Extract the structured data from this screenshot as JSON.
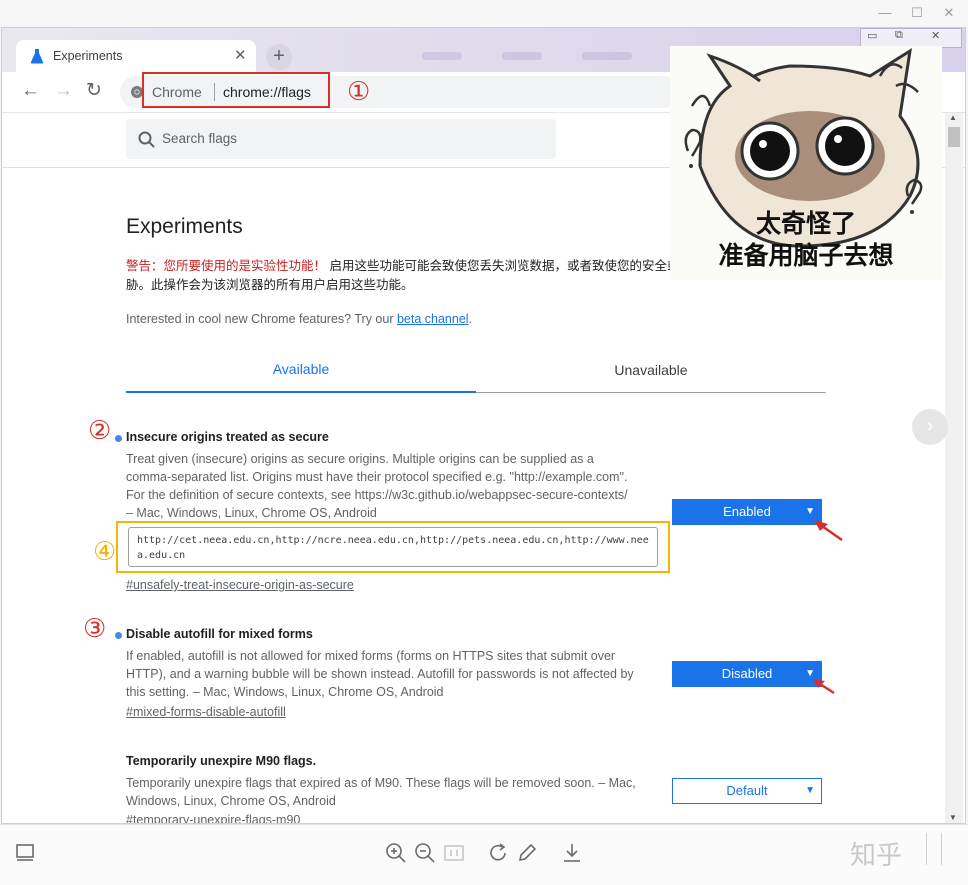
{
  "browser": {
    "tab_title": "Experiments",
    "new_tab_label": "+",
    "address": {
      "scheme_label": "Chrome",
      "url": "chrome://flags"
    }
  },
  "page": {
    "search_placeholder": "Search flags",
    "heading": "Experiments",
    "warning_red": "警告：您所要使用的是实验性功能！",
    "warning_rest": " 启用这些功能可能会致使您丢失浏览数据，或者致使您的安全或隐私受到威",
    "warning_line2": "胁。此操作会为该浏览器的所有用户启用这些功能。",
    "interest_text": "Interested in cool new Chrome features? Try our ",
    "beta_link": "beta channel",
    "interest_end": ".",
    "tabs": [
      {
        "label": "Available",
        "active": true
      },
      {
        "label": "Unavailable",
        "active": false
      }
    ]
  },
  "flags": [
    {
      "title": "Insecure origins treated as secure",
      "desc": [
        "Treat given (insecure) origins as secure origins. Multiple origins can be supplied as a",
        "comma-separated list. Origins must have their protocol specified e.g. \"http://example.com\".",
        "For the definition of secure contexts, see https://w3c.github.io/webappsec-secure-contexts/",
        "– Mac, Windows, Linux, Chrome OS, Android"
      ],
      "textarea": "http://cet.neea.edu.cn,http://ncre.neea.edu.cn,http://pets.neea.edu.cn,http://www.neea.edu.cn",
      "link": "#unsafely-treat-insecure-origin-as-secure",
      "select": "Enabled"
    },
    {
      "title": "Disable autofill for mixed forms",
      "desc": [
        "If enabled, autofill is not allowed for mixed forms (forms on HTTPS sites that submit over",
        "HTTP), and a warning bubble will be shown instead. Autofill for passwords is not affected by",
        "this setting. – Mac, Windows, Linux, Chrome OS, Android"
      ],
      "link": "#mixed-forms-disable-autofill",
      "select": "Disabled"
    },
    {
      "title": "Temporarily unexpire M90 flags.",
      "desc": [
        "Temporarily unexpire flags that expired as of M90. These flags will be removed soon. – Mac,",
        "Windows, Linux, Chrome OS, Android"
      ],
      "link": "#temporary-unexpire-flags-m90",
      "select": "Default"
    }
  ],
  "annotations": {
    "n1": "①",
    "n2": "②",
    "n3": "③",
    "n4": "④"
  },
  "sticker": {
    "line1": "太奇怪了",
    "line2": "准备用脑子去想"
  },
  "viewer": {
    "watermark": "知乎"
  },
  "colors": {
    "accent": "#1a73e8",
    "annotation_red": "#d6302a",
    "annotation_yellow": "#f2b705"
  }
}
